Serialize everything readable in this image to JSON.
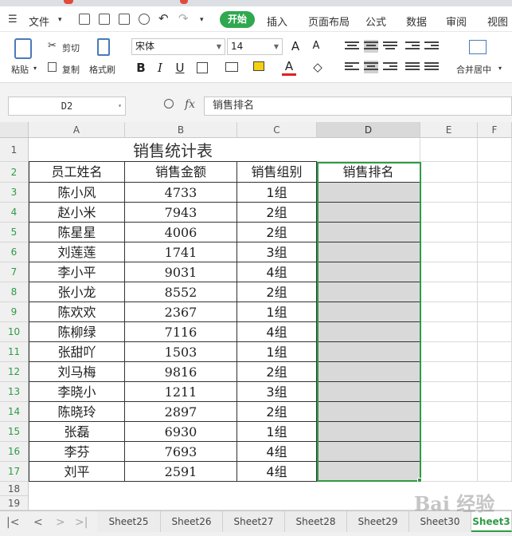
{
  "menubar": {
    "file_label": "文件",
    "tabs": [
      {
        "label": "开始"
      },
      {
        "label": "插入"
      },
      {
        "label": "页面布局"
      },
      {
        "label": "公式"
      },
      {
        "label": "数据"
      },
      {
        "label": "审阅"
      },
      {
        "label": "视图"
      }
    ]
  },
  "ribbon": {
    "paste": "粘贴",
    "cut": "剪切",
    "copy": "复制",
    "format_painter": "格式刷",
    "font_name": "宋体",
    "font_size": "14",
    "merge_center": "合并居中"
  },
  "formula_bar": {
    "name_box": "D2",
    "fx": "fx",
    "formula": "销售排名"
  },
  "columns": [
    "A",
    "B",
    "C",
    "D",
    "E",
    "F"
  ],
  "rows": [
    "1",
    "2",
    "3",
    "4",
    "5",
    "6",
    "7",
    "8",
    "9",
    "10",
    "11",
    "12",
    "13",
    "14",
    "15",
    "16",
    "17",
    "18",
    "19"
  ],
  "table": {
    "title": "销售统计表",
    "headers": [
      "员工姓名",
      "销售金额",
      "销售组别",
      "销售排名"
    ],
    "data": [
      {
        "name": "陈小风",
        "amount": "4733",
        "group": "1组"
      },
      {
        "name": "赵小米",
        "amount": "7943",
        "group": "2组"
      },
      {
        "name": "陈星星",
        "amount": "4006",
        "group": "2组"
      },
      {
        "name": "刘莲莲",
        "amount": "1741",
        "group": "3组"
      },
      {
        "name": "李小平",
        "amount": "9031",
        "group": "4组"
      },
      {
        "name": "张小龙",
        "amount": "8552",
        "group": "2组"
      },
      {
        "name": "陈欢欢",
        "amount": "2367",
        "group": "1组"
      },
      {
        "name": "陈柳绿",
        "amount": "7116",
        "group": "4组"
      },
      {
        "name": "张甜吖",
        "amount": "1503",
        "group": "1组"
      },
      {
        "name": "刘马梅",
        "amount": "9816",
        "group": "2组"
      },
      {
        "name": "李晓小",
        "amount": "1211",
        "group": "3组"
      },
      {
        "name": "陈晓玲",
        "amount": "2897",
        "group": "2组"
      },
      {
        "name": "张磊",
        "amount": "6930",
        "group": "1组"
      },
      {
        "name": "李芬",
        "amount": "7693",
        "group": "4组"
      },
      {
        "name": "刘平",
        "amount": "2591",
        "group": "4组"
      }
    ]
  },
  "sheets": [
    {
      "label": "Sheet25"
    },
    {
      "label": "Sheet26"
    },
    {
      "label": "Sheet27"
    },
    {
      "label": "Sheet28"
    },
    {
      "label": "Sheet29"
    },
    {
      "label": "Sheet30"
    },
    {
      "label": "Sheet3"
    }
  ],
  "watermark": "Bai 经验",
  "colors": {
    "accent": "#2e9b45",
    "selection_fill": "#d9d9d9"
  }
}
